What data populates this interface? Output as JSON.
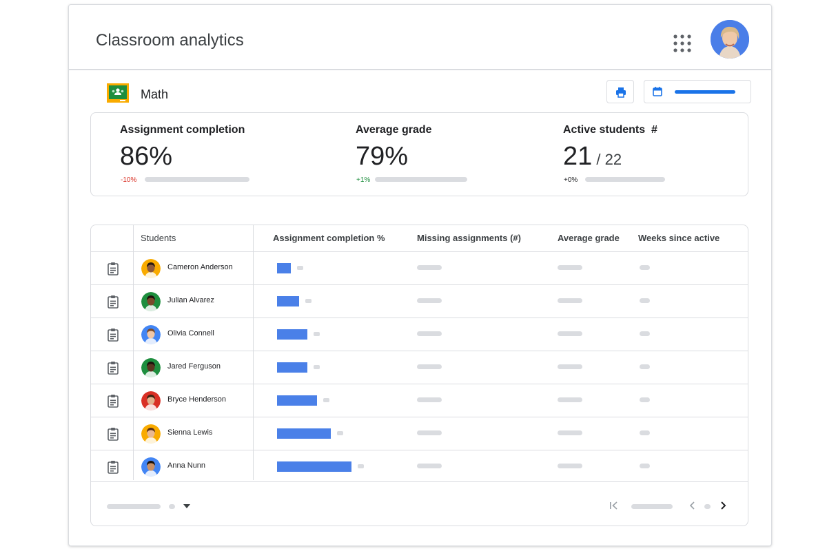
{
  "app": {
    "title": "Classroom analytics",
    "apps_icon": "apps-grid-icon",
    "avatar_icon": "user-avatar"
  },
  "class": {
    "name": "Math",
    "icon": "google-classroom-icon"
  },
  "toolbar": {
    "print_icon": "print-icon",
    "calendar_icon": "calendar-icon"
  },
  "stats": [
    {
      "label": "Assignment completion",
      "value": "86%",
      "suffix": "",
      "delta": "-10%",
      "delta_color": "#d93025"
    },
    {
      "label": "Average grade",
      "value": "79%",
      "suffix": "",
      "delta": "+1%",
      "delta_color": "#1e8e3e"
    },
    {
      "label": "Active students  #",
      "value": "21",
      "suffix": " / 22",
      "delta": "+0%",
      "delta_color": "#202124"
    }
  ],
  "table": {
    "headers": [
      "Students",
      "Assignment completion %",
      "Missing assignments (#)",
      "Average grade",
      "Weeks since active"
    ],
    "rows": [
      {
        "name": "Cameron Anderson",
        "completion_bar_fraction": 0.17
      },
      {
        "name": "Julian Alvarez",
        "completion_bar_fraction": 0.27
      },
      {
        "name": "Olivia Connell",
        "completion_bar_fraction": 0.37
      },
      {
        "name": "Jared  Ferguson",
        "completion_bar_fraction": 0.37
      },
      {
        "name": "Bryce Henderson",
        "completion_bar_fraction": 0.48
      },
      {
        "name": "Sienna Lewis",
        "completion_bar_fraction": 0.65
      },
      {
        "name": "Anna Nunn",
        "completion_bar_fraction": 0.9
      }
    ]
  },
  "colors": {
    "accent": "#1a73e8",
    "bar": "#4a80e8",
    "placeholder": "#dadce0",
    "border": "#dadce0"
  }
}
